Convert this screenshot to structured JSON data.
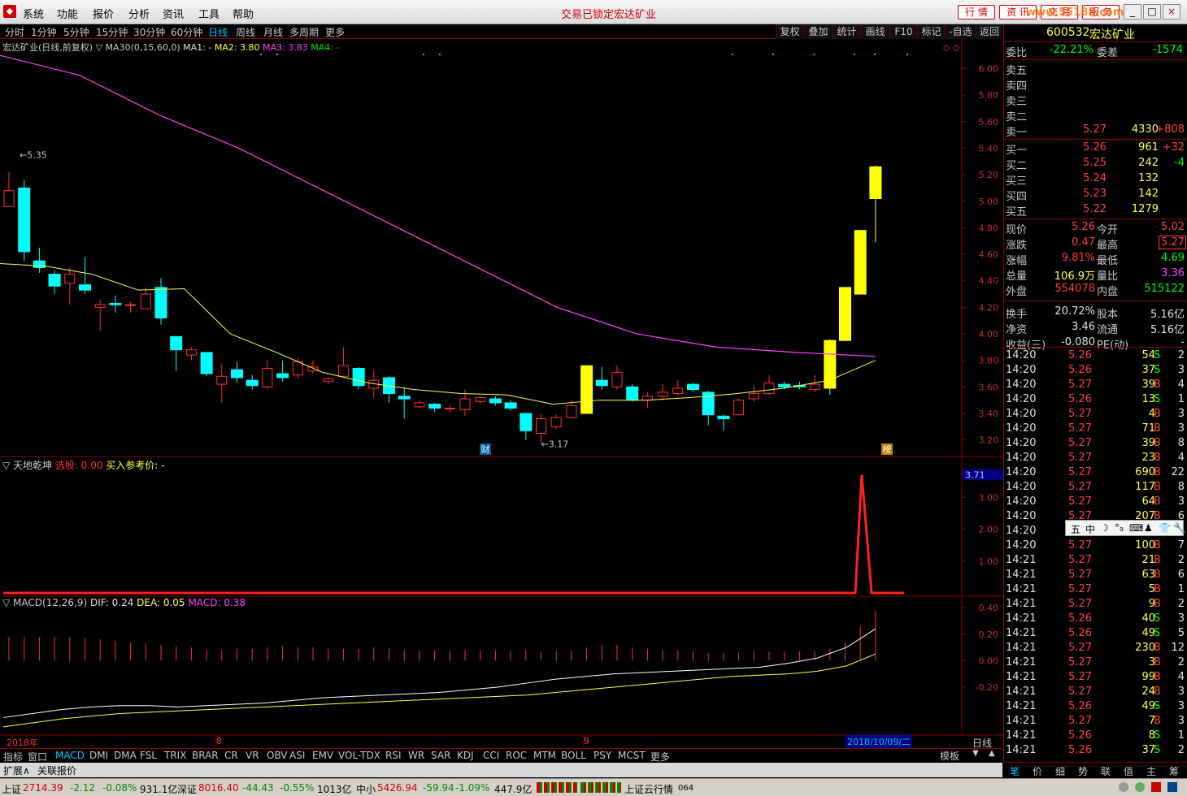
{
  "menubar": {
    "items": [
      "系统",
      "功能",
      "报价",
      "分析",
      "资讯",
      "工具",
      "帮助"
    ],
    "lock_msg": "交易已锁定",
    "stock_name": "宏达矿业",
    "quick": [
      "行 情",
      "资 讯",
      "交 易",
      "服 务"
    ],
    "watermark": "www.55188.com"
  },
  "periods": [
    "分时",
    "1分钟",
    "5分钟",
    "15分钟",
    "30分钟",
    "60分钟",
    "日线",
    "周线",
    "月线",
    "多周期",
    "更多"
  ],
  "tools": [
    "复权",
    "叠加",
    "统计",
    "画线",
    "F10",
    "标记",
    "-自选",
    "返回"
  ],
  "chart_info": {
    "title": "宏达矿业(日线,前复权)",
    "ma_label": "▽ MA30(0,15,60,0)",
    "ma1": "MA1: -",
    "ma2": "MA2: 3.80",
    "ma3": "MA3: 3.83",
    "ma4": "MA4: -"
  },
  "chart_data": [
    {
      "type": "candlestick",
      "title": "宏达矿业(日线,前复权)",
      "ylim": [
        3.1,
        6.15
      ],
      "yticks": [
        6.0,
        5.8,
        5.6,
        5.4,
        5.2,
        5.0,
        4.8,
        4.6,
        4.4,
        4.2,
        4.0,
        3.8,
        3.6,
        3.4,
        3.2
      ],
      "annotations": {
        "high": "5.35",
        "low": "3.17",
        "marker_cai": "财",
        "marker_bang": "榜"
      },
      "candles": [
        [
          4.96,
          5.08,
          5.22,
          4.96
        ],
        [
          5.1,
          4.62,
          5.16,
          4.55
        ],
        [
          4.55,
          4.5,
          4.65,
          4.46
        ],
        [
          4.45,
          4.36,
          4.48,
          4.3
        ],
        [
          4.38,
          4.45,
          4.5,
          4.22
        ],
        [
          4.37,
          4.33,
          4.58,
          4.3
        ],
        [
          4.2,
          4.22,
          4.26,
          4.02
        ],
        [
          4.23,
          4.22,
          4.29,
          4.16
        ],
        [
          4.22,
          4.22,
          4.24,
          4.16
        ],
        [
          4.19,
          4.3,
          4.35,
          4.19
        ],
        [
          4.35,
          4.12,
          4.42,
          4.07
        ],
        [
          3.98,
          3.88,
          3.98,
          3.72
        ],
        [
          3.84,
          3.88,
          3.9,
          3.8
        ],
        [
          3.86,
          3.7,
          3.86,
          3.68
        ],
        [
          3.62,
          3.68,
          3.77,
          3.48
        ],
        [
          3.73,
          3.67,
          3.79,
          3.63
        ],
        [
          3.65,
          3.61,
          3.69,
          3.58
        ],
        [
          3.6,
          3.74,
          3.8,
          3.58
        ],
        [
          3.7,
          3.67,
          3.8,
          3.64
        ],
        [
          3.69,
          3.79,
          3.82,
          3.66
        ],
        [
          3.72,
          3.75,
          3.8,
          3.7
        ],
        [
          3.64,
          3.66,
          3.67,
          3.62
        ],
        [
          3.68,
          3.76,
          3.9,
          3.67
        ],
        [
          3.74,
          3.61,
          3.75,
          3.58
        ],
        [
          3.59,
          3.65,
          3.72,
          3.52
        ],
        [
          3.67,
          3.55,
          3.68,
          3.48
        ],
        [
          3.53,
          3.51,
          3.6,
          3.36
        ],
        [
          3.45,
          3.48,
          3.5,
          3.44
        ],
        [
          3.47,
          3.44,
          3.48,
          3.41
        ],
        [
          3.44,
          3.44,
          3.46,
          3.4
        ],
        [
          3.43,
          3.51,
          3.58,
          3.38
        ],
        [
          3.49,
          3.52,
          3.53,
          3.47
        ],
        [
          3.51,
          3.48,
          3.53,
          3.46
        ],
        [
          3.48,
          3.44,
          3.5,
          3.42
        ],
        [
          3.4,
          3.27,
          3.4,
          3.2
        ],
        [
          3.25,
          3.36,
          3.4,
          3.17
        ],
        [
          3.3,
          3.37,
          3.39,
          3.28
        ],
        [
          3.37,
          3.46,
          3.5,
          3.36
        ],
        [
          3.4,
          3.76,
          3.76,
          3.4
        ],
        [
          3.65,
          3.61,
          3.75,
          3.58
        ],
        [
          3.6,
          3.71,
          3.76,
          3.58
        ],
        [
          3.6,
          3.5,
          3.62,
          3.49
        ],
        [
          3.5,
          3.53,
          3.56,
          3.44
        ],
        [
          3.53,
          3.56,
          3.62,
          3.5
        ],
        [
          3.55,
          3.59,
          3.65,
          3.53
        ],
        [
          3.62,
          3.58,
          3.63,
          3.56
        ],
        [
          3.56,
          3.39,
          3.57,
          3.31
        ],
        [
          3.38,
          3.36,
          3.39,
          3.27
        ],
        [
          3.39,
          3.5,
          3.51,
          3.39
        ],
        [
          3.51,
          3.55,
          3.61,
          3.49
        ],
        [
          3.55,
          3.63,
          3.69,
          3.54
        ],
        [
          3.62,
          3.6,
          3.64,
          3.58
        ],
        [
          3.61,
          3.6,
          3.64,
          3.58
        ],
        [
          3.58,
          3.62,
          3.69,
          3.56
        ],
        [
          3.59,
          3.95,
          3.96,
          3.54
        ],
        [
          3.95,
          4.35,
          4.35,
          3.95
        ],
        [
          4.3,
          4.78,
          4.78,
          4.3
        ],
        [
          5.02,
          5.26,
          5.27,
          4.69
        ]
      ],
      "ma_slow": [
        6.1,
        5.95,
        5.65,
        5.4,
        5.1,
        4.8,
        4.5,
        4.2,
        4.0,
        3.9,
        3.86,
        3.83
      ],
      "ma_fast": [
        4.53,
        4.51,
        4.45,
        4.33,
        4.34,
        4.0,
        3.86,
        3.71,
        3.63,
        3.58,
        3.55,
        3.54,
        3.47,
        3.5,
        3.5,
        3.52,
        3.55,
        3.59,
        3.65,
        3.8
      ]
    },
    {
      "type": "line",
      "title": "天地乾坤",
      "ylim": [
        0,
        4.0
      ],
      "yticks": [
        3.0,
        2.0,
        1.0
      ],
      "values": [
        0,
        0,
        0,
        0,
        0,
        3.71,
        0,
        0
      ],
      "current": "3.71"
    },
    {
      "type": "bar",
      "title": "MACD(12,26,9)",
      "ylim": [
        -0.55,
        0.45
      ],
      "yticks": [
        0.4,
        0.2,
        0.0,
        -0.2
      ],
      "macd": [
        0.18,
        0.18,
        0.18,
        0.18,
        0.18,
        0.17,
        0.16,
        0.15,
        0.14,
        0.13,
        0.12,
        0.11,
        0.1,
        0.08,
        0.08,
        0.09,
        0.09,
        0.1,
        0.11,
        0.1,
        0.1,
        0.09,
        0.09,
        0.09,
        0.1,
        0.09,
        0.08,
        0.08,
        0.08,
        0.07,
        0.08,
        0.08,
        0.08,
        0.07,
        0.08,
        0.07,
        0.07,
        0.08,
        0.1,
        0.12,
        0.12,
        0.1,
        0.09,
        0.08,
        0.08,
        0.07,
        0.06,
        0.06,
        0.06,
        0.07,
        0.07,
        0.07,
        0.07,
        0.07,
        0.09,
        0.14,
        0.26,
        0.38
      ],
      "dif": [
        -0.43,
        -0.4,
        -0.37,
        -0.35,
        -0.34,
        -0.34,
        -0.35,
        -0.34,
        -0.33,
        -0.32,
        -0.3,
        -0.28,
        -0.27,
        -0.26,
        -0.25,
        -0.24,
        -0.22,
        -0.2,
        -0.17,
        -0.14,
        -0.12,
        -0.1,
        -0.09,
        -0.08,
        -0.07,
        -0.06,
        -0.05,
        -0.02,
        0.02,
        0.1,
        0.24
      ],
      "dea": [
        -0.5,
        -0.47,
        -0.44,
        -0.42,
        -0.4,
        -0.39,
        -0.38,
        -0.37,
        -0.36,
        -0.35,
        -0.34,
        -0.33,
        -0.32,
        -0.31,
        -0.3,
        -0.29,
        -0.28,
        -0.27,
        -0.26,
        -0.24,
        -0.22,
        -0.2,
        -0.18,
        -0.16,
        -0.14,
        -0.12,
        -0.11,
        -0.1,
        -0.08,
        -0.04,
        0.05
      ]
    }
  ],
  "indicator": {
    "name": "▽ 天地乾坤",
    "pick_label": "选股:",
    "pick_val": "0.00",
    "ref_label": "买入参考价:",
    "ref_val": "-",
    "current": "3.71"
  },
  "macd": {
    "name": "▽ MACD(12,26,9)",
    "dif": "DIF: 0.24",
    "dea": "DEA: 0.05",
    "macd": "MACD: 0.38"
  },
  "xaxis": {
    "year": "2018年",
    "m8": "8",
    "m9": "9",
    "date": "2018/10/09/二",
    "period": "日线"
  },
  "bottom_tabs": [
    "指标",
    "窗口",
    "MACD",
    "DMI",
    "DMA",
    "FSL",
    "TRIX",
    "BRAR",
    "CR",
    "VR",
    "OBV",
    "ASI",
    "EMV",
    "VOL-TDX",
    "RSI",
    "WR",
    "SAR",
    "KDJ",
    "CCI",
    "ROC",
    "MTM",
    "BOLL",
    "PSY",
    "MCST",
    "更多"
  ],
  "bottom_right": [
    "模板",
    "▼",
    "▲"
  ],
  "expand": {
    "left": "扩展∧",
    "quote": "关联报价"
  },
  "quote": {
    "code": "600532",
    "name": "宏达矿业",
    "wb_label": "委比",
    "wb": "-22.21%",
    "wc_label": "委差",
    "wc": "-1574",
    "sells": [
      {
        "label": "卖五",
        "price": "",
        "vol": "",
        "chg": ""
      },
      {
        "label": "卖四",
        "price": "",
        "vol": "",
        "chg": ""
      },
      {
        "label": "卖三",
        "price": "",
        "vol": "",
        "chg": ""
      },
      {
        "label": "卖二",
        "price": "",
        "vol": "",
        "chg": ""
      },
      {
        "label": "卖一",
        "price": "5.27",
        "vol": "4330",
        "chg": "+808"
      }
    ],
    "buys": [
      {
        "label": "买一",
        "price": "5.26",
        "vol": "961",
        "chg": "+32"
      },
      {
        "label": "买二",
        "price": "5.25",
        "vol": "242",
        "chg": "-4"
      },
      {
        "label": "买三",
        "price": "5.24",
        "vol": "132",
        "chg": ""
      },
      {
        "label": "买四",
        "price": "5.23",
        "vol": "142",
        "chg": ""
      },
      {
        "label": "买五",
        "price": "5.22",
        "vol": "1279",
        "chg": ""
      }
    ],
    "stats": [
      [
        "现价",
        "5.26",
        "今开",
        "5.02"
      ],
      [
        "涨跌",
        "0.47",
        "最高",
        "5.27"
      ],
      [
        "涨幅",
        "9.81%",
        "最低",
        "4.69"
      ],
      [
        "总量",
        "106.9万",
        "量比",
        "3.36"
      ],
      [
        "外盘",
        "554078",
        "内盘",
        "515122"
      ],
      [
        "换手",
        "20.72%",
        "股本",
        "5.16亿"
      ],
      [
        "净资",
        "3.46",
        "流通",
        "5.16亿"
      ],
      [
        "收益(三)",
        "-0.080",
        "PE(动)",
        "-"
      ]
    ],
    "ticks": [
      [
        "14:20",
        "5.26",
        "54",
        "S",
        "2"
      ],
      [
        "14:20",
        "5.26",
        "37",
        "S",
        "3"
      ],
      [
        "14:20",
        "5.27",
        "39",
        "B",
        "4"
      ],
      [
        "14:20",
        "5.26",
        "13",
        "S",
        "1"
      ],
      [
        "14:20",
        "5.27",
        "4",
        "B",
        "3"
      ],
      [
        "14:20",
        "5.27",
        "71",
        "B",
        "3"
      ],
      [
        "14:20",
        "5.27",
        "39",
        "B",
        "8"
      ],
      [
        "14:20",
        "5.27",
        "23",
        "B",
        "4"
      ],
      [
        "14:20",
        "5.27",
        "690",
        "B",
        "22"
      ],
      [
        "14:20",
        "5.27",
        "117",
        "B",
        "8"
      ],
      [
        "14:20",
        "5.27",
        "64",
        "B",
        "3"
      ],
      [
        "14:20",
        "5.27",
        "207",
        "B",
        "6"
      ],
      [
        "14:20",
        "",
        "",
        "",
        ""
      ],
      [
        "14:20",
        "5.27",
        "100",
        "B",
        "7"
      ],
      [
        "14:21",
        "5.27",
        "21",
        "B",
        "2"
      ],
      [
        "14:21",
        "5.27",
        "63",
        "B",
        "6"
      ],
      [
        "14:21",
        "5.27",
        "5",
        "B",
        "1"
      ],
      [
        "14:21",
        "5.27",
        "9",
        "B",
        "2"
      ],
      [
        "14:21",
        "5.26",
        "40",
        "S",
        "3"
      ],
      [
        "14:21",
        "5.26",
        "49",
        "S",
        "5"
      ],
      [
        "14:21",
        "5.27",
        "230",
        "B",
        "12"
      ],
      [
        "14:21",
        "5.27",
        "3",
        "B",
        "2"
      ],
      [
        "14:21",
        "5.27",
        "99",
        "B",
        "4"
      ],
      [
        "14:21",
        "5.27",
        "24",
        "B",
        "3"
      ],
      [
        "14:21",
        "5.26",
        "49",
        "S",
        "3"
      ],
      [
        "14:21",
        "5.27",
        "7",
        "B",
        "3"
      ],
      [
        "14:21",
        "5.26",
        "8",
        "S",
        "1"
      ],
      [
        "14:21",
        "5.26",
        "37",
        "S",
        "2"
      ]
    ]
  },
  "right_tabs": [
    "笔",
    "价",
    "细",
    "势",
    "联",
    "值",
    "主",
    "筹"
  ],
  "ime": [
    "五",
    "中",
    "☽",
    "°₉",
    "⌨",
    "♟",
    "👕",
    "🔧"
  ],
  "statusbar": {
    "sh_label": "上证",
    "sh_val": "2714.39",
    "sh_chg": "-2.12",
    "sh_pct": "-0.08%",
    "sh_amt": "931.1亿",
    "sz_label": "深证",
    "sz_val": "8016.40",
    "sz_chg": "-44.43",
    "sz_pct": "-0.55%",
    "sz_amt": "1013亿",
    "zx_label": "中小",
    "zx_val": "5426.94",
    "zx_chg": "-59.94",
    "zx_pct": "-1.09%",
    "zx_amt": "447.9亿",
    "cloud": "上证云行情",
    "cloud_id": "064"
  }
}
